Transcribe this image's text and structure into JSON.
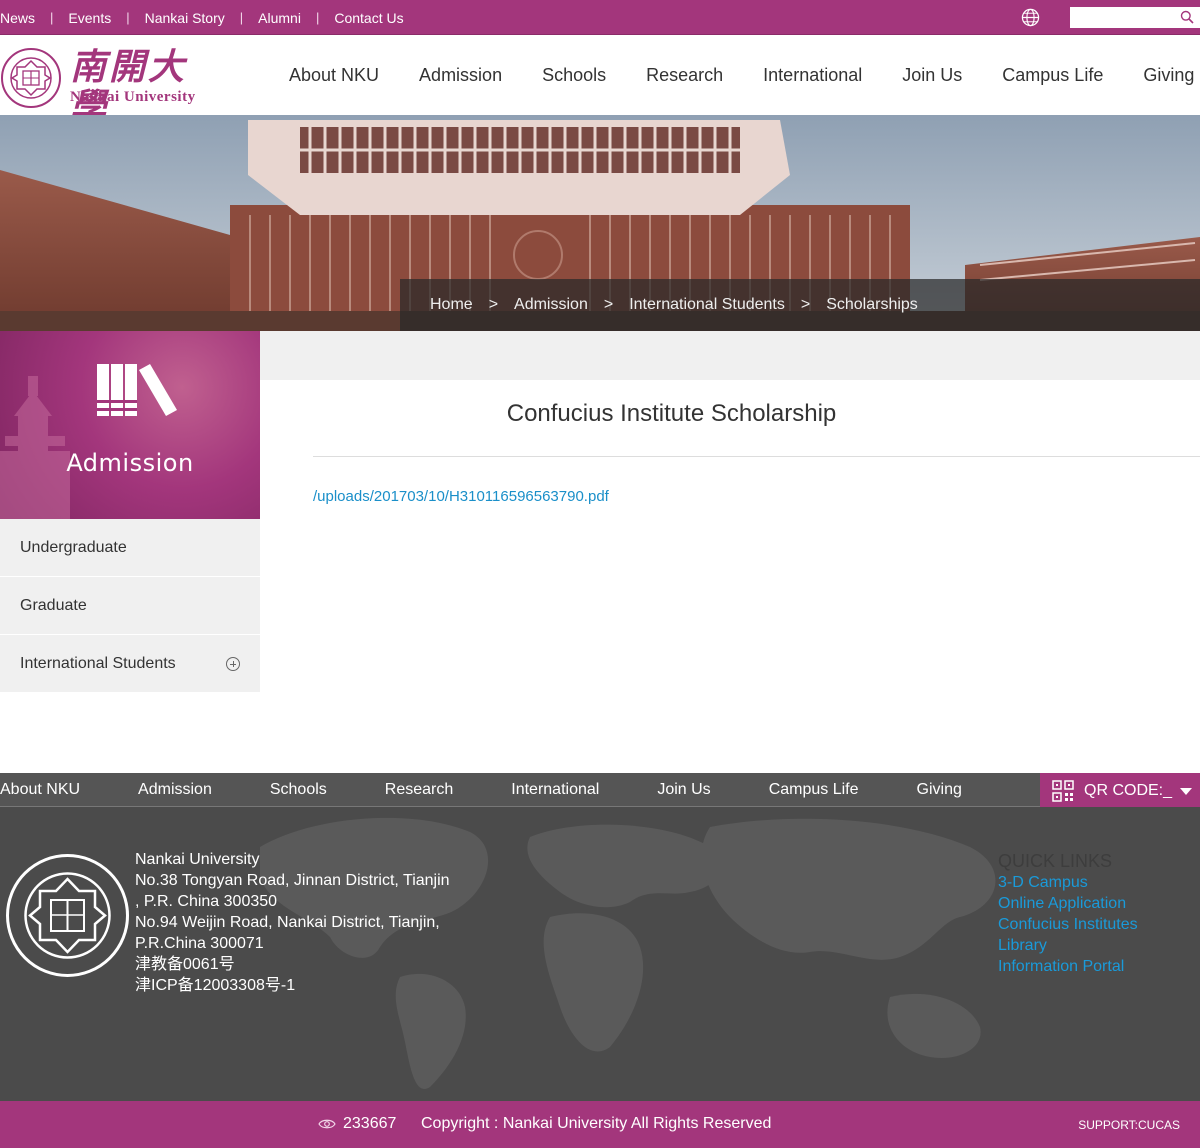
{
  "topbar": {
    "links": [
      "News",
      "Events",
      "Nankai Story",
      "Alumni",
      "Contact Us"
    ],
    "search_placeholder": ""
  },
  "logo": {
    "chinese_name": "南開大學",
    "english_name": "Nankai University"
  },
  "main_nav": [
    "About NKU",
    "Admission",
    "Schools",
    "Research",
    "International",
    "Join Us",
    "Campus Life",
    "Giving"
  ],
  "breadcrumb": [
    "Home",
    "Admission",
    "International Students",
    "Scholarships"
  ],
  "breadcrumb_separator": ">",
  "sidebar": {
    "title": "Admission",
    "items": [
      {
        "label": "Undergraduate",
        "expandable": false
      },
      {
        "label": "Graduate",
        "expandable": false
      },
      {
        "label": "International Students",
        "expandable": true
      }
    ]
  },
  "article": {
    "title": "Confucius Institute Scholarship",
    "link": "/uploads/201703/10/H310116596563790.pdf"
  },
  "footer_nav": [
    "About NKU",
    "Admission",
    "Schools",
    "Research",
    "International",
    "Join Us",
    "Campus Life",
    "Giving"
  ],
  "qr_label": "QR CODE:_",
  "footer": {
    "address_lines": [
      "Nankai University",
      "No.38 Tongyan Road, Jinnan District, Tianjin",
      ", P.R. China 300350",
      "No.94 Weijin Road,  Nankai District, Tianjin,",
      "P.R.China  300071",
      "津教备0061号",
      "津ICP备12003308号-1"
    ],
    "quick_links_title": "QUICK LINKS",
    "quick_links": [
      "3-D Campus",
      "Online Application",
      "Confucius Institutes",
      "Library",
      "Information Portal"
    ]
  },
  "copyright": {
    "visits": "233667",
    "text": "Copyright : Nankai University All Rights Reserved",
    "support": "SUPPORT:CUCAS"
  },
  "colors": {
    "brand": "#a3367c",
    "link": "#1a8fc9",
    "footer_bg": "#4b4b4b"
  }
}
